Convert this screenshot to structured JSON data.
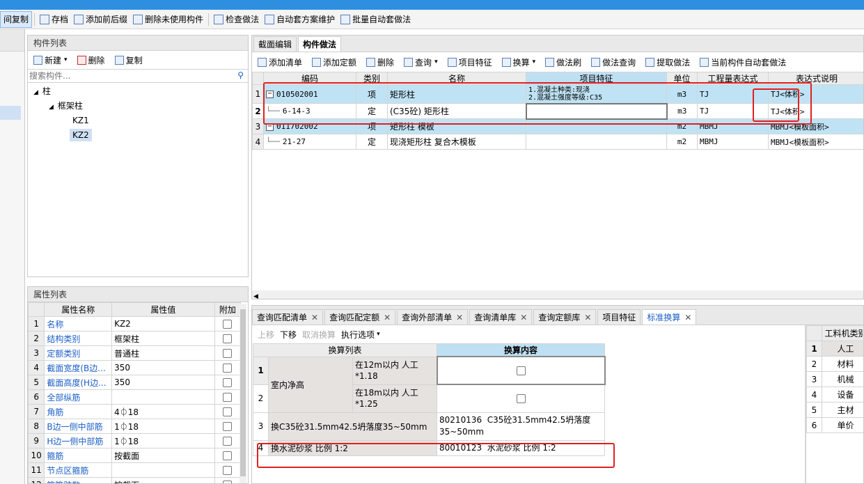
{
  "toolbar": {
    "items": [
      {
        "label": "间复制",
        "icon": "copy-icon"
      },
      {
        "label": "存档",
        "icon": "save-icon"
      },
      {
        "label": "添加前后缀",
        "icon": "prefix-icon"
      },
      {
        "label": "删除未使用构件",
        "icon": "delete-unused-icon"
      },
      {
        "label": "检查做法",
        "icon": "check-icon"
      },
      {
        "label": "自动套方案维护",
        "icon": "scheme-icon"
      },
      {
        "label": "批量自动套做法",
        "icon": "batch-icon"
      }
    ]
  },
  "component_list": {
    "title": "构件列表",
    "new_label": "新建",
    "delete_label": "删除",
    "copy_label": "复制",
    "search_placeholder": "搜索构件...",
    "tree": {
      "root": "柱",
      "child": "框架柱",
      "leaves": [
        "KZ1",
        "KZ2"
      ]
    }
  },
  "property_list": {
    "title": "属性列表",
    "headers": [
      "属性名称",
      "属性值",
      "附加"
    ],
    "rows": [
      {
        "n": "1",
        "name": "名称",
        "value": "KZ2"
      },
      {
        "n": "2",
        "name": "结构类别",
        "value": "框架柱"
      },
      {
        "n": "3",
        "name": "定额类别",
        "value": "普通柱"
      },
      {
        "n": "4",
        "name": "截面宽度(B边...",
        "value": "350"
      },
      {
        "n": "5",
        "name": "截面高度(H边...",
        "value": "350"
      },
      {
        "n": "6",
        "name": "全部纵筋",
        "value": ""
      },
      {
        "n": "7",
        "name": "角筋",
        "value": "4⏀18"
      },
      {
        "n": "8",
        "name": "B边一侧中部筋",
        "value": "1⏀18"
      },
      {
        "n": "9",
        "name": "H边一侧中部筋",
        "value": "1⏀18"
      },
      {
        "n": "10",
        "name": "箍筋",
        "value": "按截面"
      },
      {
        "n": "11",
        "name": "节点区箍筋",
        "value": ""
      },
      {
        "n": "12",
        "name": "箍筋肢数",
        "value": "按截面"
      }
    ]
  },
  "method_panel": {
    "tabs": [
      "截面编辑",
      "构件做法"
    ],
    "tools": [
      "添加清单",
      "添加定额",
      "删除",
      "查询",
      "项目特征",
      "换算",
      "做法刷",
      "做法查询",
      "提取做法",
      "当前构件自动套做法"
    ],
    "headers": [
      "编码",
      "类别",
      "名称",
      "项目特征",
      "单位",
      "工程量表达式",
      "表达式说明"
    ],
    "rows": [
      {
        "n": "1",
        "code": "010502001",
        "type": "项",
        "name": "矩形柱",
        "feature": "1.混凝土种类:现浇\n2.混凝土强度等级:C35",
        "unit": "m3",
        "expr": "TJ",
        "desc": "TJ<体积>"
      },
      {
        "n": "2",
        "code": "6-14-3",
        "type": "定",
        "name": "(C35砼) 矩形柱",
        "feature": "",
        "unit": "m3",
        "expr": "TJ",
        "desc": "TJ<体积>"
      },
      {
        "n": "3",
        "code": "011702002",
        "type": "项",
        "name": "矩形柱 模板",
        "feature": "",
        "unit": "m2",
        "expr": "MBMJ",
        "desc": "MBMJ<模板面积>"
      },
      {
        "n": "4",
        "code": "21-27",
        "type": "定",
        "name": "现浇矩形柱 复合木模板",
        "feature": "",
        "unit": "m2",
        "expr": "MBMJ",
        "desc": "MBMJ<模板面积>"
      }
    ]
  },
  "bottom_panel": {
    "tabs": [
      "查询匹配清单",
      "查询匹配定额",
      "查询外部清单",
      "查询清单库",
      "查询定额库",
      "项目特征",
      "标准换算"
    ],
    "actions": [
      "上移",
      "下移",
      "取消换算",
      "执行选项"
    ],
    "headers": [
      "换算列表",
      "换算内容"
    ],
    "rows": [
      {
        "n": "1",
        "group": "室内净高",
        "item": "在12m以内 人工\n*1.18",
        "content": ""
      },
      {
        "n": "2",
        "group": "",
        "item": "在18m以内 人工\n*1.25",
        "content": ""
      },
      {
        "n": "3",
        "group": "换C35砼31.5mm42.5坍落度35~50mm",
        "item": "",
        "content": "80210136  C35砼31.5mm42.5坍落度\n35~50mm"
      },
      {
        "n": "4",
        "group": "换水泥砂浆 比例 1:2",
        "item": "",
        "content": "80010123  水泥砂浆 比例 1:2"
      }
    ]
  },
  "resource_panel": {
    "header": "工料机类别",
    "rows": [
      {
        "n": "1",
        "label": "人工"
      },
      {
        "n": "2",
        "label": "材料"
      },
      {
        "n": "3",
        "label": "机械"
      },
      {
        "n": "4",
        "label": "设备"
      },
      {
        "n": "5",
        "label": "主材"
      },
      {
        "n": "6",
        "label": "单价"
      }
    ]
  }
}
